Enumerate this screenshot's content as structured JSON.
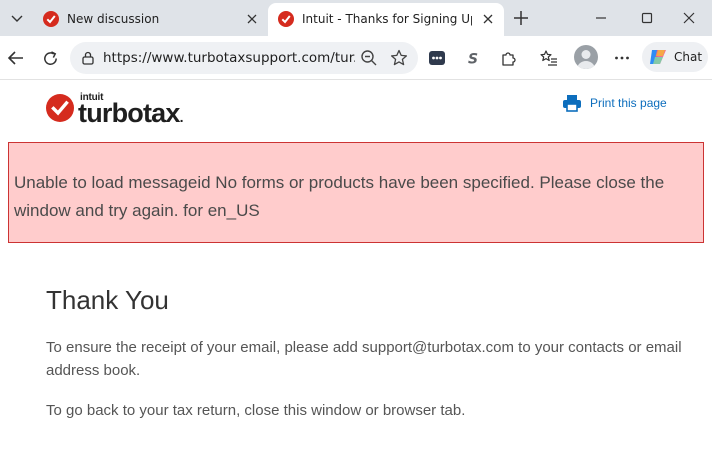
{
  "browser": {
    "tabs": [
      {
        "title": "New discussion",
        "favicon": "turbotax-check-icon",
        "active": false
      },
      {
        "title": "Intuit - Thanks for Signing Up",
        "favicon": "turbotax-check-icon",
        "active": true
      }
    ],
    "address": {
      "url": "https://www.turbotaxsupport.com/tur..."
    },
    "chat_label": "Chat"
  },
  "page": {
    "logo": {
      "company": "intuit",
      "brand": "turbotax",
      "brand_suffix": "."
    },
    "print_label": "Print this page",
    "error_message": "Unable to load messageid No forms or products have been specified. Please close the window and try again. for en_US",
    "heading": "Thank You",
    "paragraph_1": "To ensure the receipt of your email, please add support@turbotax.com to your contacts or email address book.",
    "paragraph_2": "To go back to your tax return, close this window or browser tab."
  },
  "colors": {
    "brand_red": "#d52b1e",
    "error_bg": "#ffcccc",
    "error_border": "#cc3333",
    "link_blue": "#0d6ebd"
  }
}
